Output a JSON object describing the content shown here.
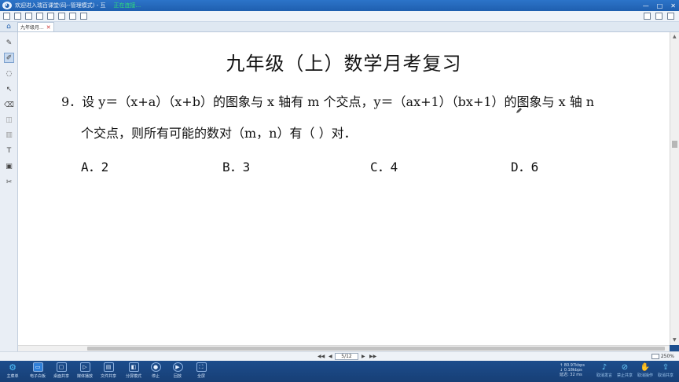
{
  "window": {
    "title": "欢迎进入瑞百课堂(码--管理模式) - 互",
    "status": "正在连接...",
    "controls": [
      "—",
      "□",
      "✕"
    ]
  },
  "tabs": {
    "doc_label": "九年级月...",
    "close": "✕"
  },
  "document": {
    "title": "九年级（上）数学月考复习",
    "question_line1": "9．设 y＝（x+a）（x+b）的图象与 x 轴有 m 个交点，y＝（ax+1）（bx+1）的图象与 x 轴 n",
    "question_line2": "个交点，则所有可能的数对（m，n）有（     ）对．",
    "options": {
      "a": "A．2",
      "b": "B．3",
      "c": "C．4",
      "d": "D．6"
    }
  },
  "pagenav": {
    "page_indicator": "5/12",
    "zoom": "250%"
  },
  "taskbar": {
    "start": "主菜单",
    "buttons": [
      "电子白板",
      "桌面共享",
      "媒体播放",
      "文件共享",
      "分屏模式",
      "停止",
      "回放",
      "全屏"
    ],
    "net_up": "↑ 80.97kbps",
    "net_down": "↓ 0.18kbps",
    "delay": "延迟: 32 ms",
    "right_buttons": [
      "取消发言",
      "禁止共享",
      "取消操作",
      "取消共享"
    ]
  },
  "colors": {
    "accent": "#1f5faf",
    "taskbar": "#1c4d8c",
    "canvas": "#ffffff"
  }
}
